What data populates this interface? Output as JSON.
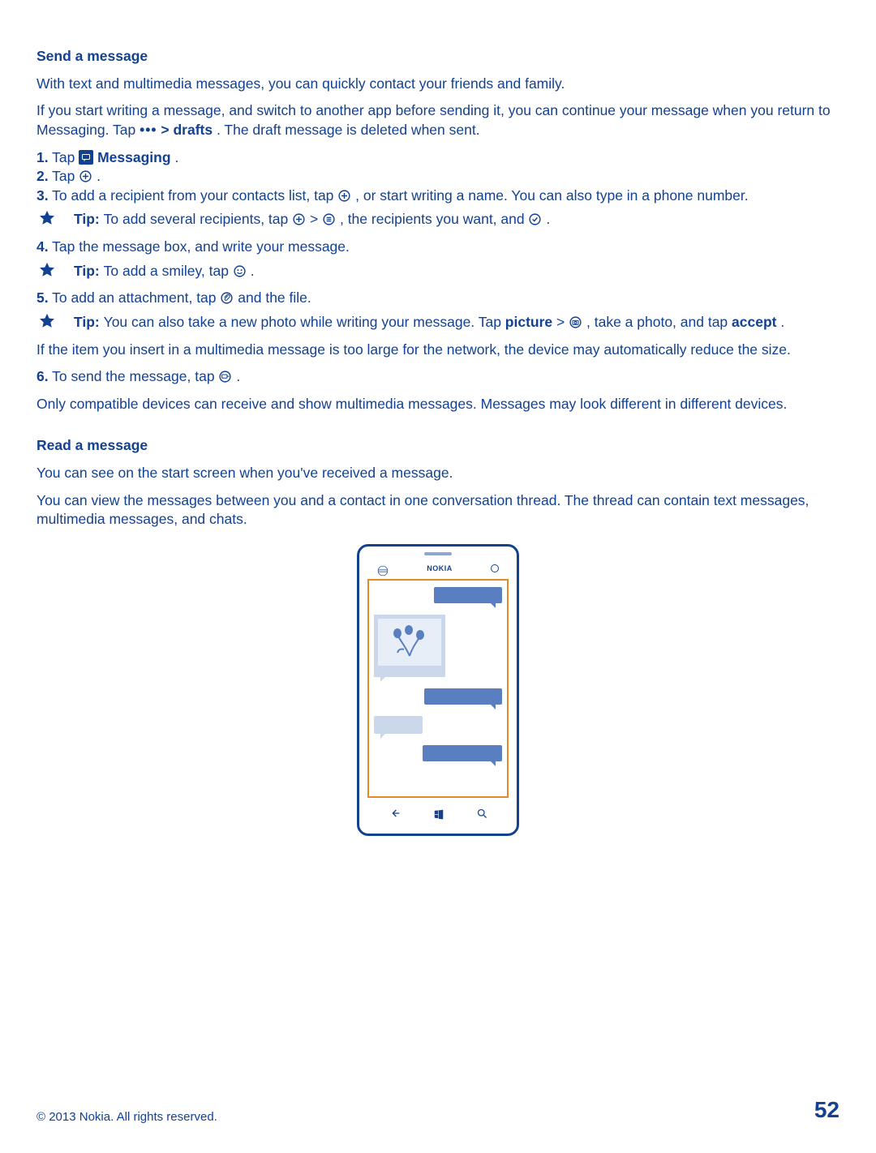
{
  "section1": {
    "heading": "Send a message",
    "intro": "With text and multimedia messages, you can quickly contact your friends and family.",
    "draft_a": "If you start writing a message, and switch to another app before sending it, you can continue your message when you return to Messaging. Tap ",
    "draft_b": " > ",
    "draft_drafts": "drafts",
    "draft_c": ". The draft message is deleted when sent.",
    "s1_n": "1.",
    "s1_a": " Tap ",
    "s1_msg": " Messaging",
    "s1_b": ".",
    "s2_n": "2.",
    "s2_a": " Tap ",
    "s2_b": ".",
    "s3_n": "3.",
    "s3_a": " To add a recipient from your contacts list, tap ",
    "s3_b": ", or start writing a name. You can also type in a phone number.",
    "tip1_lead": "Tip: ",
    "tip1_a": "To add several recipients, tap ",
    "tip1_b": " > ",
    "tip1_c": ", the recipients you want, and ",
    "tip1_d": ".",
    "s4_n": "4.",
    "s4_a": " Tap the message box, and write your message.",
    "tip2_lead": "Tip: ",
    "tip2_a": "To add a smiley, tap ",
    "tip2_b": ".",
    "s5_n": "5.",
    "s5_a": " To add an attachment, tap ",
    "s5_b": " and the file.",
    "tip3_lead": "Tip: ",
    "tip3_a": "You can also take a new photo while writing your message. Tap ",
    "tip3_pic": "picture",
    "tip3_b": " > ",
    "tip3_c": ", take a photo, and tap ",
    "tip3_accept": "accept",
    "tip3_d": ".",
    "toolarge": "If the item you insert in a multimedia message is too large for the network, the device may automatically reduce the size.",
    "s6_n": "6.",
    "s6_a": " To send the message, tap ",
    "s6_b": ".",
    "compat": "Only compatible devices can receive and show multimedia messages. Messages may look different in different devices."
  },
  "section2": {
    "heading": "Read a message",
    "p1": "You can see on the start screen when you've received a message.",
    "p2": "You can view the messages between you and a contact in one conversation thread. The thread can contain text messages, multimedia messages, and chats."
  },
  "phone": {
    "brand": "NOKIA"
  },
  "footer": {
    "copyright": "© 2013 Nokia. All rights reserved.",
    "page": "52"
  }
}
